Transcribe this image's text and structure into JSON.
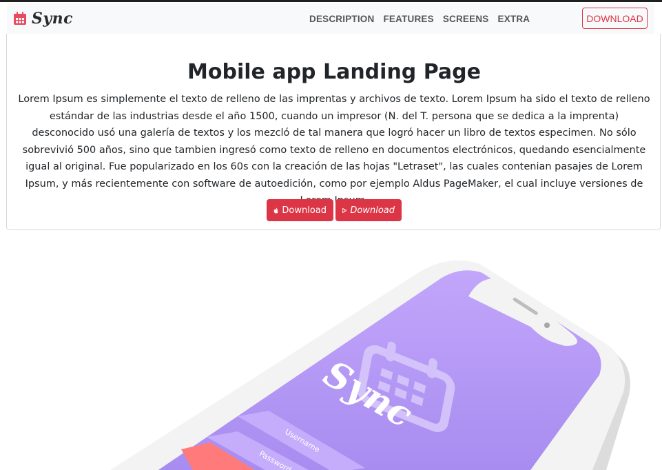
{
  "brand": {
    "name": "Sync",
    "icon": "calendar-icon",
    "color": "#dc3545"
  },
  "nav": {
    "links": [
      "DESCRIPTION",
      "FEATURES",
      "SCREENS",
      "EXTRA"
    ],
    "download_label": "DOWNLOAD"
  },
  "hero": {
    "title": "Mobile app Landing Page",
    "text": "Lorem Ipsum es simplemente el texto de relleno de las imprentas y archivos de texto. Lorem Ipsum ha sido el texto de relleno estándar de las industrias desde el año 1500, cuando un impresor (N. del T. persona que se dedica a la imprenta) desconocido usó una galería de textos y los mezcló de tal manera que logró hacer un libro de textos especimen. No sólo sobrevivió 500 años, sino que tambien ingresó como texto de relleno en documentos electrónicos, quedando esencialmente igual al original. Fue popularizado en los 60s con la creación de las hojas \"Letraset\", las cuales contenian pasajes de Lorem Ipsum, y más recientemente con software de autoedición, como por ejemplo Aldus PageMaker, el cual incluye versiones de Lorem Ipsum.",
    "button_apple": {
      "label": "Download",
      "icon": "apple-icon"
    },
    "button_play": {
      "label": "Download",
      "icon": "google-play-icon"
    }
  },
  "phone": {
    "app_name": "Sync",
    "username_placeholder": "Username",
    "password_placeholder": "Password",
    "screen_color": "#b79bf7",
    "button_color": "#ff7b7b"
  }
}
